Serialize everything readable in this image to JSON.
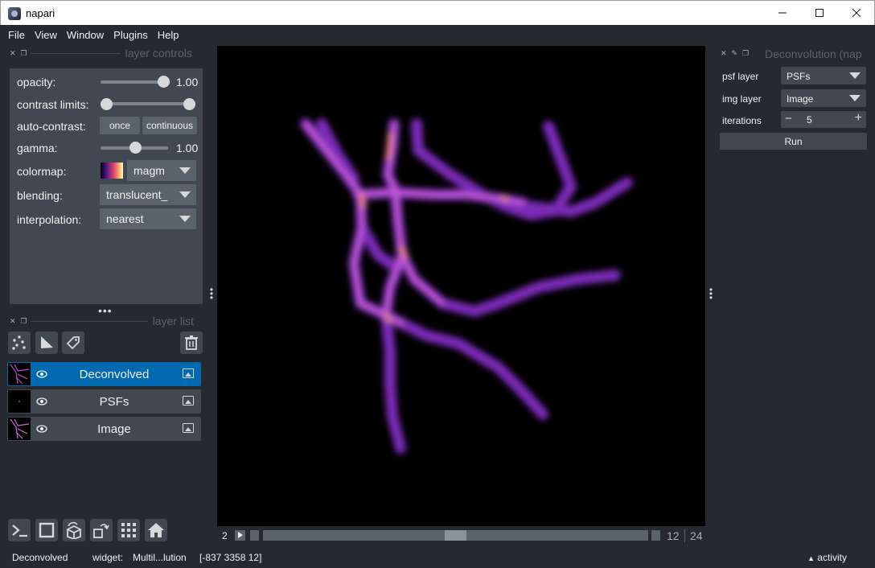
{
  "window": {
    "title": "napari"
  },
  "menu": [
    "File",
    "View",
    "Window",
    "Plugins",
    "Help"
  ],
  "layer_controls": {
    "title": "layer controls",
    "opacity_label": "opacity:",
    "opacity_value": "1.00",
    "contrast_label": "contrast limits:",
    "autocontrast_label": "auto-contrast:",
    "once_label": "once",
    "continuous_label": "continuous",
    "gamma_label": "gamma:",
    "gamma_value": "1.00",
    "colormap_label": "colormap:",
    "colormap_value": "magm",
    "blending_label": "blending:",
    "blending_value": "translucent_",
    "interpolation_label": "interpolation:",
    "interpolation_value": "nearest",
    "opacity_level": 1.0,
    "gamma_level": 0.5
  },
  "layer_list": {
    "title": "layer list",
    "layers": [
      {
        "name": "Deconvolved",
        "selected": true
      },
      {
        "name": "PSFs",
        "selected": false
      },
      {
        "name": "Image",
        "selected": false
      }
    ]
  },
  "dims": {
    "index": "2",
    "current": "12",
    "total": "24"
  },
  "plugin": {
    "title": "Deconvolution (nap",
    "psf_label": "psf layer",
    "psf_value": "PSFs",
    "img_label": "img layer",
    "img_value": "Image",
    "iter_label": "iterations",
    "iter_value": "5",
    "run_label": "Run"
  },
  "status": {
    "layer": "Deconvolved",
    "widget_label": "widget:",
    "widget_value": "Multil...lution",
    "coords": "[-837 3358 12]",
    "activity": "activity"
  },
  "colors": {
    "selected": "#0069b0",
    "panel": "#414851",
    "background": "#262930"
  },
  "icons": [
    "points-icon",
    "shapes-icon",
    "labels-icon",
    "delete-icon",
    "console-icon",
    "ndisplay-icon",
    "roll-icon",
    "transpose-icon",
    "grid-icon",
    "home-icon",
    "eye-icon",
    "image-layer-icon"
  ]
}
